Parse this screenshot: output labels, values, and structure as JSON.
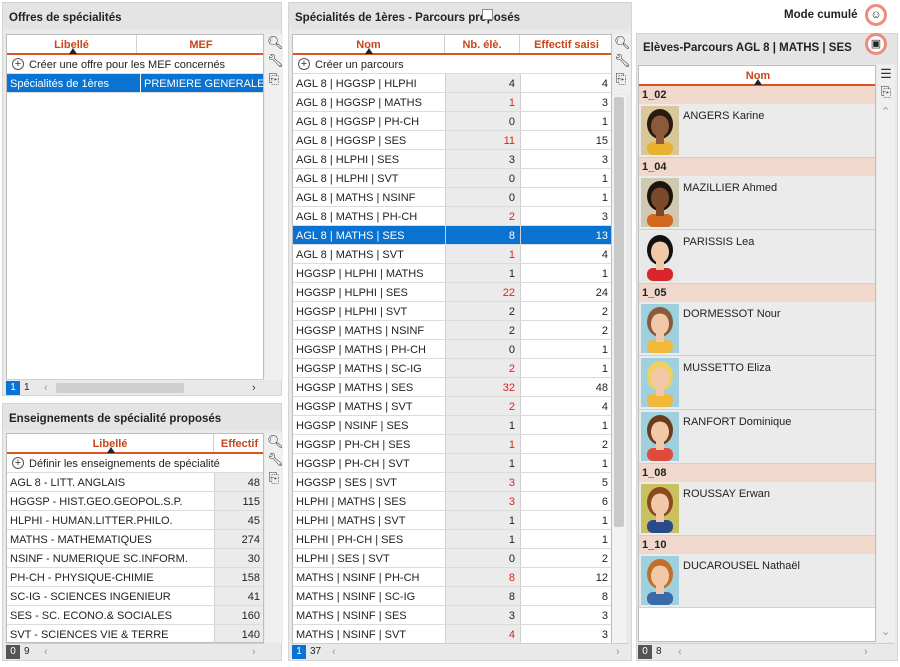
{
  "left_top": {
    "title": "Offres de spécialités",
    "col_libelle": "Libellé",
    "col_mef": "MEF",
    "add_label": "Créer une offre pour les MEF concernés",
    "rows": [
      {
        "libelle": "Spécialités de 1ères",
        "mef": "PREMIERE GENERALE"
      }
    ],
    "page_current": "1",
    "page_total": "1"
  },
  "left_bottom": {
    "title": "Enseignements de spécialité proposés",
    "col_libelle": "Libellé",
    "col_effectif": "Effectif",
    "add_label": "Définir les enseignements de spécialité",
    "rows": [
      {
        "libelle": "AGL 8 - LITT. ANGLAIS",
        "effectif": "48"
      },
      {
        "libelle": "HGGSP - HIST.GEO.GEOPOL.S.P.",
        "effectif": "115"
      },
      {
        "libelle": "HLPHI - HUMAN.LITTER.PHILO.",
        "effectif": "45"
      },
      {
        "libelle": "MATHS - MATHEMATIQUES",
        "effectif": "274"
      },
      {
        "libelle": "NSINF - NUMERIQUE SC.INFORM.",
        "effectif": "30"
      },
      {
        "libelle": "PH-CH - PHYSIQUE-CHIMIE",
        "effectif": "158"
      },
      {
        "libelle": "SC-IG - SCIENCES INGENIEUR",
        "effectif": "41"
      },
      {
        "libelle": "SES - SC. ECONO.& SOCIALES",
        "effectif": "160"
      },
      {
        "libelle": "SVT - SCIENCES VIE & TERRE",
        "effectif": "140"
      }
    ],
    "page_current": "0",
    "page_total": "9"
  },
  "middle": {
    "title": "Spécialités de 1ères - Parcours proposés",
    "mode_cumule": "Mode cumulé",
    "col_nom": "Nom",
    "col_nb": "Nb. élè.",
    "col_eff": "Effectif saisi",
    "add_label": "Créer un parcours",
    "rows": [
      {
        "nom": "AGL 8 | HGGSP | HLPHI",
        "nb": "4",
        "eff": "4",
        "red": false,
        "sel": false
      },
      {
        "nom": "AGL 8 | HGGSP | MATHS",
        "nb": "1",
        "eff": "3",
        "red": true,
        "sel": false
      },
      {
        "nom": "AGL 8 | HGGSP | PH-CH",
        "nb": "0",
        "eff": "1",
        "red": false,
        "sel": false
      },
      {
        "nom": "AGL 8 | HGGSP | SES",
        "nb": "11",
        "eff": "15",
        "red": true,
        "sel": false
      },
      {
        "nom": "AGL 8 | HLPHI | SES",
        "nb": "3",
        "eff": "3",
        "red": false,
        "sel": false
      },
      {
        "nom": "AGL 8 | HLPHI | SVT",
        "nb": "0",
        "eff": "1",
        "red": false,
        "sel": false
      },
      {
        "nom": "AGL 8 | MATHS | NSINF",
        "nb": "0",
        "eff": "1",
        "red": false,
        "sel": false
      },
      {
        "nom": "AGL 8 | MATHS | PH-CH",
        "nb": "2",
        "eff": "3",
        "red": true,
        "sel": false
      },
      {
        "nom": "AGL 8 | MATHS | SES",
        "nb": "8",
        "eff": "13",
        "red": true,
        "sel": true
      },
      {
        "nom": "AGL 8 | MATHS | SVT",
        "nb": "1",
        "eff": "4",
        "red": true,
        "sel": false
      },
      {
        "nom": "HGGSP | HLPHI | MATHS",
        "nb": "1",
        "eff": "1",
        "red": false,
        "sel": false
      },
      {
        "nom": "HGGSP | HLPHI | SES",
        "nb": "22",
        "eff": "24",
        "red": true,
        "sel": false
      },
      {
        "nom": "HGGSP | HLPHI | SVT",
        "nb": "2",
        "eff": "2",
        "red": false,
        "sel": false
      },
      {
        "nom": "HGGSP | MATHS | NSINF",
        "nb": "2",
        "eff": "2",
        "red": false,
        "sel": false
      },
      {
        "nom": "HGGSP | MATHS | PH-CH",
        "nb": "0",
        "eff": "1",
        "red": false,
        "sel": false
      },
      {
        "nom": "HGGSP | MATHS | SC-IG",
        "nb": "2",
        "eff": "1",
        "red": true,
        "sel": false
      },
      {
        "nom": "HGGSP | MATHS | SES",
        "nb": "32",
        "eff": "48",
        "red": true,
        "sel": false
      },
      {
        "nom": "HGGSP | MATHS | SVT",
        "nb": "2",
        "eff": "4",
        "red": true,
        "sel": false
      },
      {
        "nom": "HGGSP | NSINF | SES",
        "nb": "1",
        "eff": "1",
        "red": false,
        "sel": false
      },
      {
        "nom": "HGGSP | PH-CH | SES",
        "nb": "1",
        "eff": "2",
        "red": true,
        "sel": false
      },
      {
        "nom": "HGGSP | PH-CH | SVT",
        "nb": "1",
        "eff": "1",
        "red": false,
        "sel": false
      },
      {
        "nom": "HGGSP | SES | SVT",
        "nb": "3",
        "eff": "5",
        "red": true,
        "sel": false
      },
      {
        "nom": "HLPHI | MATHS | SES",
        "nb": "3",
        "eff": "6",
        "red": true,
        "sel": false
      },
      {
        "nom": "HLPHI | MATHS | SVT",
        "nb": "1",
        "eff": "1",
        "red": false,
        "sel": false
      },
      {
        "nom": "HLPHI | PH-CH | SES",
        "nb": "1",
        "eff": "1",
        "red": false,
        "sel": false
      },
      {
        "nom": "HLPHI | SES | SVT",
        "nb": "0",
        "eff": "2",
        "red": false,
        "sel": false
      },
      {
        "nom": "MATHS | NSINF | PH-CH",
        "nb": "8",
        "eff": "12",
        "red": true,
        "sel": false
      },
      {
        "nom": "MATHS | NSINF | SC-IG",
        "nb": "8",
        "eff": "8",
        "red": false,
        "sel": false
      },
      {
        "nom": "MATHS | NSINF | SES",
        "nb": "3",
        "eff": "3",
        "red": false,
        "sel": false
      },
      {
        "nom": "MATHS | NSINF | SVT",
        "nb": "4",
        "eff": "3",
        "red": true,
        "sel": false
      }
    ],
    "page_current": "1",
    "page_total": "37"
  },
  "right": {
    "title": "Elèves-Parcours AGL 8 | MATHS | SES",
    "col_nom": "Nom",
    "groups": [
      {
        "label": "1_02",
        "students": [
          {
            "name": "ANGERS Karine",
            "avatar": "female-dark"
          }
        ]
      },
      {
        "label": "1_04",
        "students": [
          {
            "name": "MAZILLIER Ahmed",
            "avatar": "male-dark"
          },
          {
            "name": "PARISSIS Lea",
            "avatar": "female-black-hair"
          }
        ]
      },
      {
        "label": "1_05",
        "students": [
          {
            "name": "DORMESSOT Nour",
            "avatar": "male-light"
          },
          {
            "name": "MUSSETTO Eliza",
            "avatar": "female-blonde"
          },
          {
            "name": "RANFORT Dominique",
            "avatar": "female-brown"
          }
        ]
      },
      {
        "label": "1_08",
        "students": [
          {
            "name": "ROUSSAY Erwan",
            "avatar": "male-brown"
          }
        ]
      },
      {
        "label": "1_10",
        "students": [
          {
            "name": "DUCAROUSEL Nathaël",
            "avatar": "male-glasses"
          }
        ]
      }
    ],
    "page_current": "0",
    "page_total": "8"
  },
  "colors": {
    "accent": "#d9541e",
    "selection": "#0a73d1",
    "red_value": "#d8261b",
    "group_bg": "#f0d8cc"
  }
}
